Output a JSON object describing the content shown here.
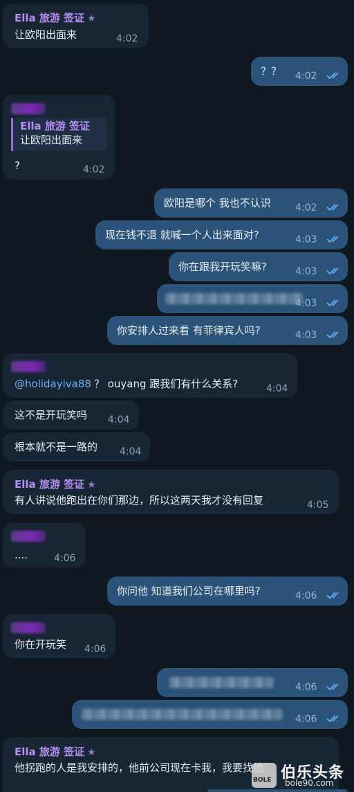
{
  "colors": {
    "background": "#0f1721",
    "incoming_bubble": "#182533",
    "outgoing_bubble": "#2b5278",
    "sender_name": "#b48ef0",
    "mention": "#6ab3f3"
  },
  "messages": [
    {
      "sender": "Ella 旅游 签证",
      "star": "★",
      "text": "让欧阳出面来",
      "time": "4:02"
    },
    {
      "text": "？？",
      "time": "4:02"
    },
    {
      "quote_name": "Ella 旅游 签证",
      "quote_text": "让欧阳出面来",
      "text": "?",
      "time": "4:02"
    },
    {
      "text": "欧阳是哪个 我也不认识",
      "time": "4:02"
    },
    {
      "text": "现在钱不退 就喊一个人出来面对?",
      "time": "4:03"
    },
    {
      "text": "你在跟我开玩笑嘛?",
      "time": "4:03"
    },
    {
      "time": "4:03"
    },
    {
      "text": "你安排人过来看 有菲律宾人吗?",
      "time": "4:03"
    },
    {
      "mention": "@holidayiva88",
      "text": "？ ouyang 跟我们有什么关系?",
      "time": "4:04"
    },
    {
      "text": "这不是开玩笑吗",
      "time": "4:04"
    },
    {
      "text": "根本就不是一路的",
      "time": "4:04"
    },
    {
      "sender": "Ella 旅游 签证",
      "star": "★",
      "text": "有人讲说他跑出在你们那边，所以这两天我才没有回复",
      "time": "4:05"
    },
    {
      "text": "....",
      "time": "4:06"
    },
    {
      "text": "你问他 知道我们公司在哪里吗?",
      "time": "4:06"
    },
    {
      "text": "你在开玩笑",
      "time": "4:06"
    },
    {
      "time": "4:06"
    },
    {
      "time": "4:06"
    },
    {
      "sender": "Ella 旅游 签证",
      "star": "★",
      "text": "他拐跑的人是我安排的，他前公司现在卡我，我要找他"
    }
  ],
  "watermark": {
    "logo_text": "伯乐头条",
    "url": "bole90.com",
    "badge": "BOLE"
  }
}
